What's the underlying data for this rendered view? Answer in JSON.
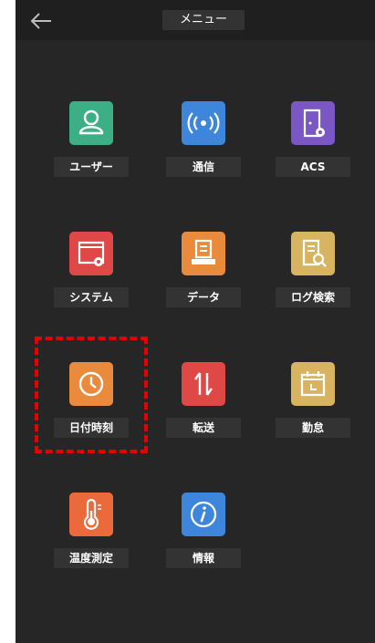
{
  "header": {
    "title": "メニュー"
  },
  "menu": [
    {
      "label": "ユーザー",
      "icon": "user-icon",
      "color": "#3daf87"
    },
    {
      "label": "通信",
      "icon": "wireless-signal-icon",
      "color": "#3d86db"
    },
    {
      "label": "ACS",
      "icon": "door-settings-icon",
      "color": "#7b56c5"
    },
    {
      "label": "システム",
      "icon": "window-settings-icon",
      "color": "#e04848"
    },
    {
      "label": "データ",
      "icon": "data-printer-icon",
      "color": "#ea8a3c"
    },
    {
      "label": "ログ検索",
      "icon": "document-search-icon",
      "color": "#d9b460"
    },
    {
      "label": "日付時刻",
      "icon": "clock-icon",
      "color": "#ea8a3c"
    },
    {
      "label": "転送",
      "icon": "transfer-arrows-icon",
      "color": "#e04848"
    },
    {
      "label": "勤怠",
      "icon": "calendar-icon",
      "color": "#d9b460"
    },
    {
      "label": "温度測定",
      "icon": "thermometer-icon",
      "color": "#ea6a3c"
    },
    {
      "label": "情報",
      "icon": "info-icon",
      "color": "#3d86db"
    }
  ]
}
